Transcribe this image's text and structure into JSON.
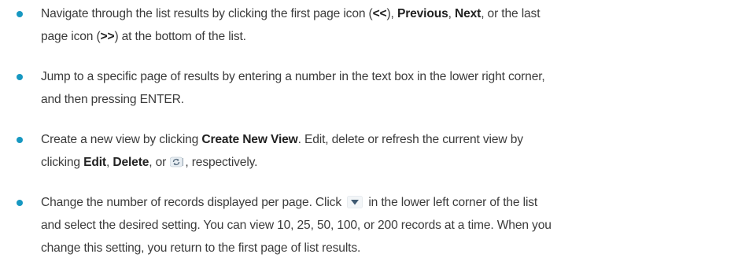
{
  "colors": {
    "bullet": "#1798c1",
    "text": "#3b3b3b"
  },
  "items": [
    {
      "t1": "Navigate through the list results by clicking the first page icon (",
      "b1": "<<",
      "t2": "), ",
      "b2": "Previous",
      "t3": ", ",
      "b3": "Next",
      "t4": ", or the last",
      "t5": "page icon (",
      "b4": ">>",
      "t6": ") at the bottom of the list."
    },
    {
      "t1": "Jump to a specific page of results by entering a number in the text box in the lower right corner,",
      "t2": "and then pressing ENTER."
    },
    {
      "t1": "Create a new view by clicking ",
      "b1": "Create New View",
      "t2": ". Edit, delete or refresh the current view by",
      "b2": "Edit",
      "t3": ", ",
      "b3": "Delete",
      "t4": ", or ",
      "icon": "refresh-icon",
      "t5": ", respectively.",
      "t0": "clicking "
    },
    {
      "t1": "Change the number of records displayed per page. Click ",
      "icon": "dropdown-arrow-icon",
      "t2": " in the lower left corner of the list",
      "t3": "and select the desired setting. You can view 10, 25, 50, 100, or 200 records at a time. When you",
      "t4": "change this setting, you return to the first page of list results."
    }
  ]
}
